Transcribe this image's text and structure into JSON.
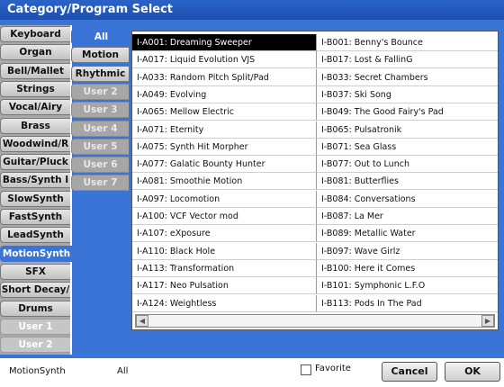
{
  "window": {
    "title": "Category/Program Select"
  },
  "categories": [
    {
      "label": "Keyboard",
      "state": "normal"
    },
    {
      "label": "Organ",
      "state": "normal"
    },
    {
      "label": "Bell/Mallet",
      "state": "normal"
    },
    {
      "label": "Strings",
      "state": "normal"
    },
    {
      "label": "Vocal/Airy",
      "state": "normal"
    },
    {
      "label": "Brass",
      "state": "normal"
    },
    {
      "label": "Woodwind/R",
      "state": "normal"
    },
    {
      "label": "Guitar/Pluck",
      "state": "normal"
    },
    {
      "label": "Bass/Synth I",
      "state": "normal"
    },
    {
      "label": "SlowSynth",
      "state": "normal"
    },
    {
      "label": "FastSynth",
      "state": "normal"
    },
    {
      "label": "LeadSynth",
      "state": "normal"
    },
    {
      "label": "MotionSynth",
      "state": "selected"
    },
    {
      "label": "SFX",
      "state": "normal"
    },
    {
      "label": "Short Decay/",
      "state": "normal"
    },
    {
      "label": "Drums",
      "state": "normal"
    },
    {
      "label": "User 1",
      "state": "disabled"
    },
    {
      "label": "User 2",
      "state": "disabled"
    }
  ],
  "subcategories": [
    {
      "label": "All",
      "state": "selected"
    },
    {
      "label": "Motion",
      "state": "normal"
    },
    {
      "label": "Rhythmic",
      "state": "normal"
    },
    {
      "label": "User 2",
      "state": "disabled"
    },
    {
      "label": "User 3",
      "state": "disabled"
    },
    {
      "label": "User 4",
      "state": "disabled"
    },
    {
      "label": "User 5",
      "state": "disabled"
    },
    {
      "label": "User 6",
      "state": "disabled"
    },
    {
      "label": "User 7",
      "state": "disabled"
    }
  ],
  "programs": {
    "columns": [
      [
        "I-A001: Dreaming Sweeper",
        "I-A017: Liquid Evolution VJS",
        "I-A033: Random Pitch Split/Pad",
        "I-A049: Evolving",
        "I-A065: Mellow Electric",
        "I-A071: Eternity",
        "I-A075: Synth Hit Morpher",
        "I-A077: Galatic Bounty Hunter",
        "I-A081: Smoothie Motion",
        "I-A097: Locomotion",
        "I-A100: VCF Vector mod",
        "I-A107: eXposure",
        "I-A110: Black Hole",
        "I-A113: Transformation",
        "I-A117: Neo Pulsation",
        "I-A124: Weightless"
      ],
      [
        "I-B001: Benny's Bounce",
        "I-B017: Lost & FallinG",
        "I-B033: Secret Chambers",
        "I-B037: Ski Song",
        "I-B049: The Good Fairy's Pad",
        "I-B065: Pulsatronik",
        "I-B071: Sea Glass",
        "I-B077: Out to Lunch",
        "I-B081: Butterflies",
        "I-B084: Conversations",
        "I-B087: La Mer",
        "I-B089: Metallic Water",
        "I-B097: Wave Girlz",
        "I-B100: Here it Comes",
        "I-B101: Symphonic L.F.O",
        "I-B113: Pods In The Pad"
      ]
    ],
    "selected": "I-A001: Dreaming Sweeper"
  },
  "footer": {
    "current_category": "MotionSynth",
    "current_subcategory": "All",
    "favorite_label": "Favorite",
    "favorite_checked": false,
    "cancel_label": "Cancel",
    "ok_label": "OK"
  },
  "icons": {
    "scroll_left": "arrow-left-icon",
    "scroll_right": "arrow-right-icon"
  },
  "colors": {
    "panel_blue": "#3a74d6",
    "title_blue": "#1d4fb0",
    "selection": "#000000"
  }
}
